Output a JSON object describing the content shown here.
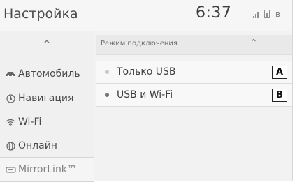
{
  "header": {
    "title": "Настройка",
    "time": "6:37",
    "status_icons": [
      "signal-icon",
      "battery-icon",
      "bluetooth-icon"
    ],
    "bluetooth_glyph": "ʙ"
  },
  "sidebar": {
    "scroll_up_glyph": "⌃",
    "items": [
      {
        "label": "Автомобиль",
        "icon": "car-icon"
      },
      {
        "label": "Навигация",
        "icon": "navigation-icon"
      },
      {
        "label": "Wi-Fi",
        "icon": "wifi-icon"
      },
      {
        "label": "Онлайн",
        "icon": "globe-icon"
      },
      {
        "label": "MirrorLink™",
        "icon": "mirrorlink-icon"
      }
    ]
  },
  "main": {
    "section_label": "Режим подключения",
    "collapse_glyph": "⌃",
    "options": [
      {
        "label": "Только USB",
        "selected": false,
        "marker": "A"
      },
      {
        "label": "USB и Wi-Fi",
        "selected": true,
        "marker": "B"
      }
    ]
  },
  "colors": {
    "background": "#f2f2f2",
    "text": "#4a4a4a",
    "selected_dot": "#757575",
    "unselected_dot": "#c9c9c9"
  }
}
